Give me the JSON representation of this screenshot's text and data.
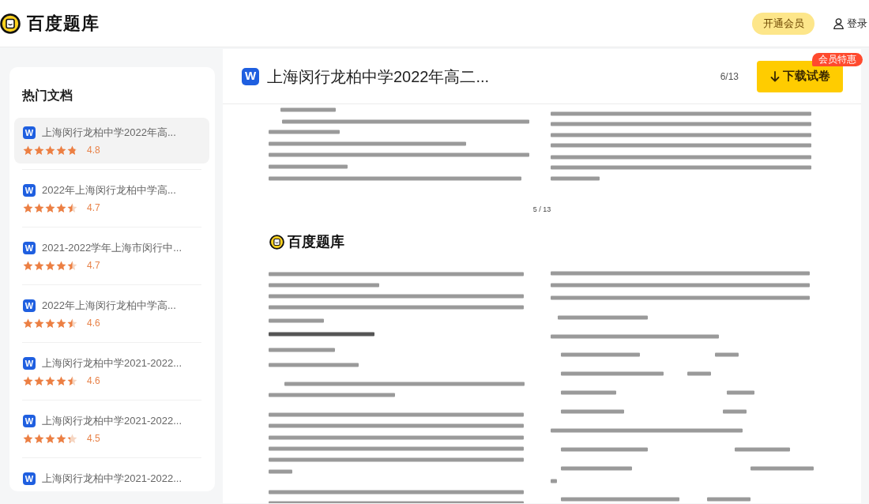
{
  "header": {
    "logo": "百度题库",
    "member_button": "开通会员",
    "login": "登录"
  },
  "sidebar": {
    "title": "热门文档",
    "items": [
      {
        "badge": "W",
        "title": "上海闵行龙柏中学2022年高...",
        "rating": "4.8",
        "stars": 4.8,
        "selected": true
      },
      {
        "badge": "W",
        "title": "2022年上海闵行龙柏中学高...",
        "rating": "4.7",
        "stars": 4.5,
        "selected": false
      },
      {
        "badge": "W",
        "title": "2021-2022学年上海市闵行中...",
        "rating": "4.7",
        "stars": 4.5,
        "selected": false
      },
      {
        "badge": "W",
        "title": "2022年上海闵行龙柏中学高...",
        "rating": "4.6",
        "stars": 4.5,
        "selected": false
      },
      {
        "badge": "W",
        "title": "上海闵行龙柏中学2021-2022...",
        "rating": "4.6",
        "stars": 4.5,
        "selected": false
      },
      {
        "badge": "W",
        "title": "上海闵行龙柏中学2021-2022...",
        "rating": "4.5",
        "stars": 4.3,
        "selected": false
      },
      {
        "badge": "W",
        "title": "上海闵行龙柏中学2021-2022...",
        "selected": false
      }
    ]
  },
  "viewer": {
    "badge": "W",
    "title": "上海闵行龙柏中学2022年高二...",
    "page_indicator": "6/13",
    "download_button": "下载试卷",
    "promo_badge": "会员特惠",
    "page_number": "5 / 13",
    "page_logo": "百度题库"
  }
}
